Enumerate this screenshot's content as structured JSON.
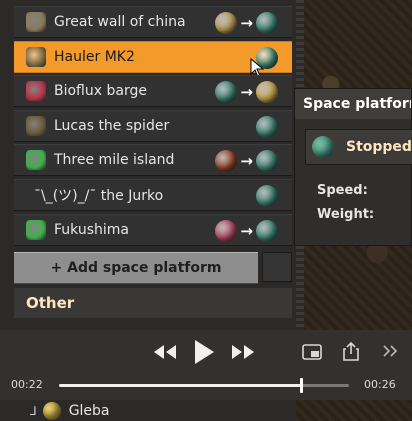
{
  "platforms": [
    {
      "label": "Great wall of china",
      "icon_color": "#8a7a5a",
      "from_planet": "#c8a45a",
      "to_planet": "#3f8a7a",
      "selected": false
    },
    {
      "label": "Hauler MK2",
      "icon_color": "#7a6a4a",
      "from_planet": null,
      "to_planet": "#3f8a7a",
      "selected": true
    },
    {
      "label": "Bioflux barge",
      "icon_color": "#b8344a",
      "from_planet": "#3f8a7a",
      "to_planet": "#d6b04a",
      "selected": false
    },
    {
      "label": "Lucas the spider",
      "icon_color": "#6a5a3a",
      "from_planet": null,
      "to_planet": "#3f8a7a",
      "selected": false
    },
    {
      "label": "Three mile island",
      "icon_color": "#3fb04a",
      "from_planet": "#a0482a",
      "to_planet": "#3f8a7a",
      "selected": false
    },
    {
      "label": "¯\\_(ツ)_/¯ the Jurko",
      "icon_color": null,
      "from_planet": null,
      "to_planet": "#3f8a7a",
      "selected": false
    },
    {
      "label": "Fukushima",
      "icon_color": "#3fb04a",
      "from_planet": "#c04a6a",
      "to_planet": "#3f8a7a",
      "selected": false
    }
  ],
  "arrow_glyph": "→",
  "add_button_label": "+ Add space platform",
  "other_header": "Other",
  "bottom_row_label": "Gleba",
  "tooltip": {
    "title": "Space platform",
    "status": "Stopped",
    "speed_label": "Speed:",
    "weight_label": "Weight:"
  },
  "player": {
    "time_elapsed": "00:22",
    "time_total": "00:26",
    "progress_fraction": 0.836,
    "icons": [
      "rewind-icon",
      "play-icon",
      "fast-forward-icon",
      "pip-icon",
      "share-icon",
      "more-icon"
    ]
  },
  "colors": {
    "accent": "#f49a2a",
    "panel": "#313131"
  }
}
